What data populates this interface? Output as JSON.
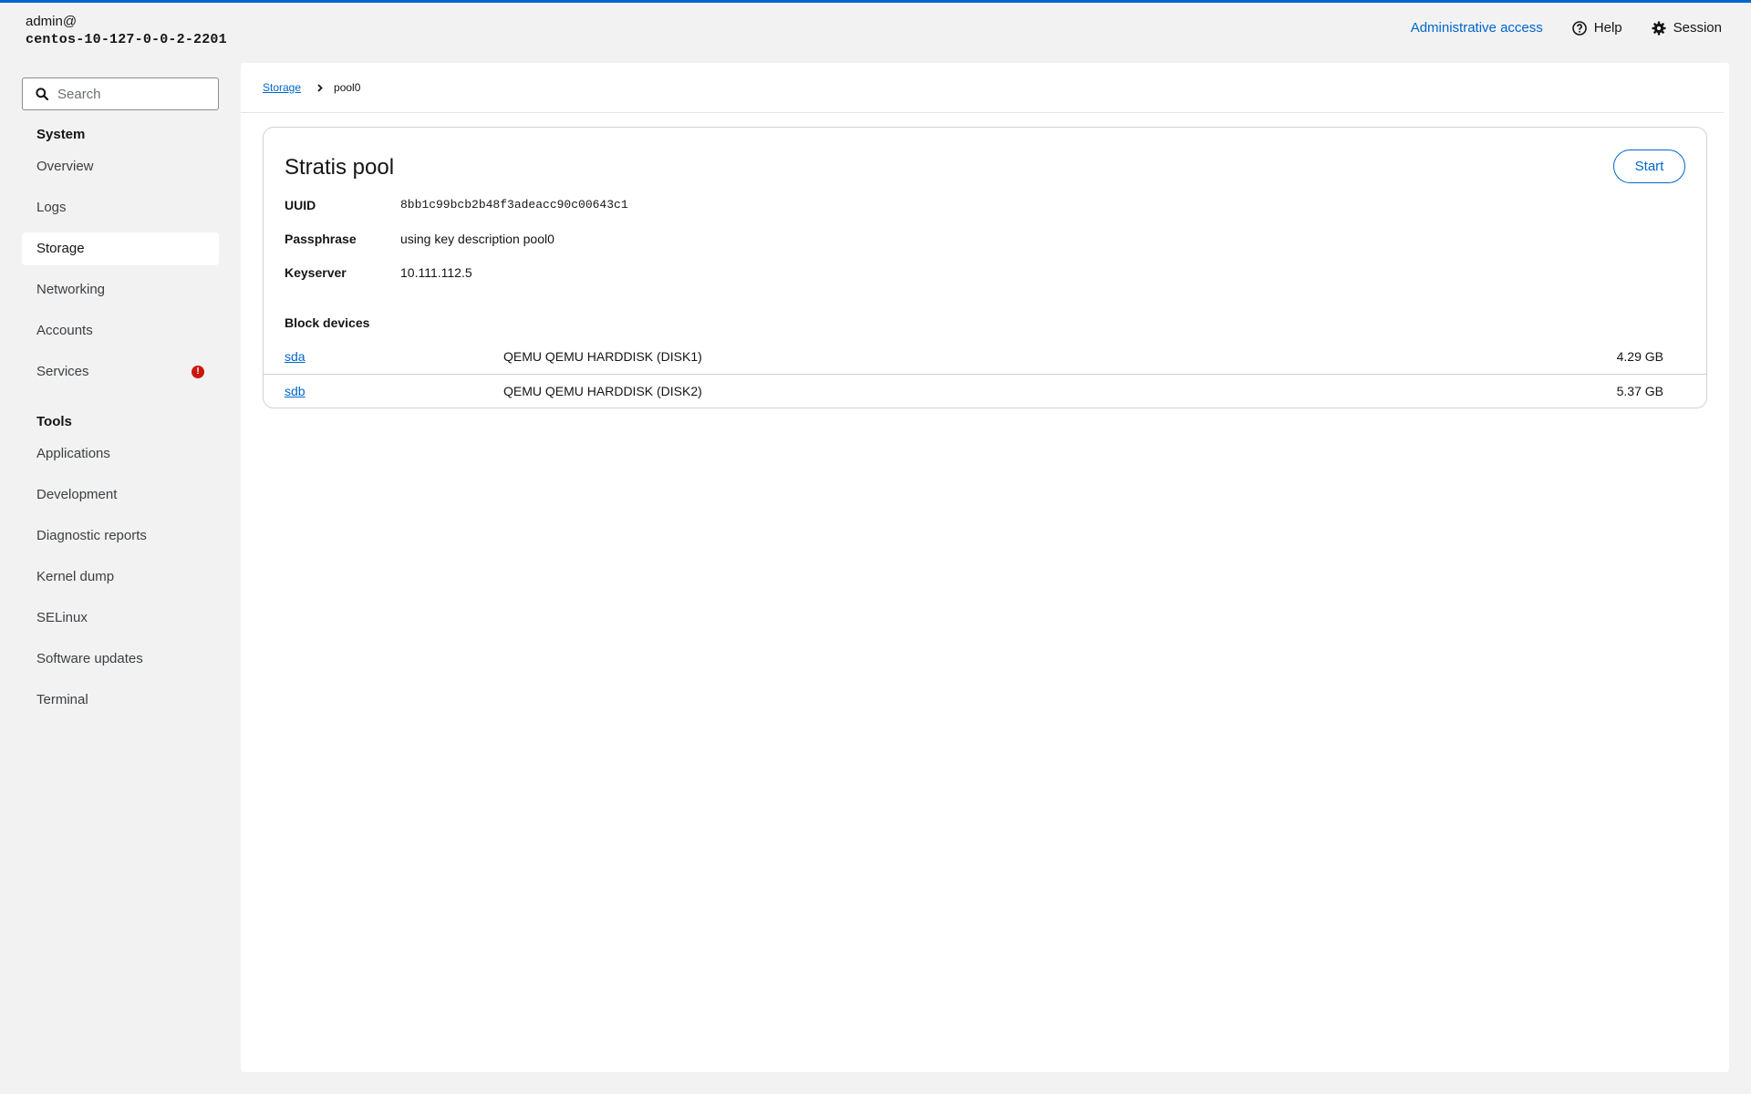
{
  "header": {
    "user": "admin@",
    "hostname": "centos-10-127-0-0-2-2201",
    "admin_access": "Administrative access",
    "help": "Help",
    "session": "Session"
  },
  "search": {
    "placeholder": "Search"
  },
  "sidebar": {
    "system_title": "System",
    "system_items": [
      {
        "label": "Overview"
      },
      {
        "label": "Logs"
      },
      {
        "label": "Storage",
        "active": true
      },
      {
        "label": "Networking"
      },
      {
        "label": "Accounts"
      },
      {
        "label": "Services",
        "badge": "!"
      }
    ],
    "tools_title": "Tools",
    "tools_items": [
      {
        "label": "Applications"
      },
      {
        "label": "Development"
      },
      {
        "label": "Diagnostic reports"
      },
      {
        "label": "Kernel dump"
      },
      {
        "label": "SELinux"
      },
      {
        "label": "Software updates"
      },
      {
        "label": "Terminal"
      }
    ]
  },
  "breadcrumb": {
    "parent": "Storage",
    "current": "pool0"
  },
  "pool": {
    "title": "Stratis pool",
    "start_label": "Start",
    "uuid_label": "UUID",
    "uuid": "8bb1c99bcb2b48f3adeacc90c00643c1",
    "passphrase_label": "Passphrase",
    "passphrase": "using key description pool0",
    "keyserver_label": "Keyserver",
    "keyserver": "10.111.112.5",
    "block_devices_label": "Block devices",
    "devices": [
      {
        "name": "sda",
        "model": "QEMU QEMU HARDDISK (DISK1)",
        "size": "4.29 GB"
      },
      {
        "name": "sdb",
        "model": "QEMU QEMU HARDDISK (DISK2)",
        "size": "5.37 GB"
      }
    ]
  },
  "colors": {
    "accent": "#0066cc",
    "alert": "#c9190b",
    "background": "#f2f2f2"
  }
}
